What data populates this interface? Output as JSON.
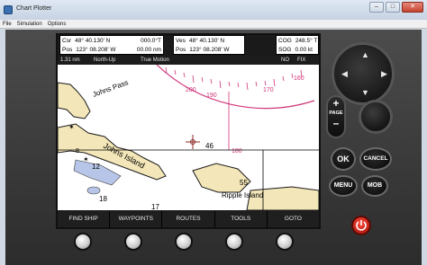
{
  "window": {
    "title": "Chart Plotter",
    "menu": [
      "File",
      "Simulation",
      "Options"
    ]
  },
  "nav_info": {
    "box1": {
      "line1": [
        "Csr",
        "48° 40.130' N",
        "000.0°T"
      ],
      "line2": [
        "Pos",
        "123° 08.208' W",
        "00.00 nm"
      ]
    },
    "box2": {
      "line1": [
        "Ves",
        "48° 40.130' N"
      ],
      "line2": [
        "Pos",
        "123° 08.208' W"
      ]
    },
    "box3": {
      "line1": [
        "COG",
        "248.5° T"
      ],
      "line2": [
        "SOG",
        "0.00 kt"
      ]
    }
  },
  "mode_bar": {
    "range": "1.31 nm",
    "orientation": "North-Up",
    "motion": "True Motion",
    "status1": "NO",
    "status2": "FIX"
  },
  "chart": {
    "places": [
      "Johns Pass",
      "Johns Island",
      "Ripple Island"
    ],
    "compass_labels": [
      "200",
      "190",
      "180",
      "170",
      "160"
    ],
    "soundings": [
      "46",
      "12",
      "18",
      "17",
      "55",
      "8"
    ],
    "colors": {
      "land": "#f3e6b8",
      "land_outline": "#1a1a1a",
      "shallow": "#b7c5e8",
      "compass": "#d0357b"
    }
  },
  "softkeys": [
    "FIND SHIP",
    "WAYPOINTS",
    "ROUTES",
    "TOOLS",
    "GOTO"
  ],
  "controls": {
    "page_label": "PAGE",
    "page_plus": "+",
    "page_minus": "–",
    "ok": "OK",
    "cancel": "CANCEL",
    "menu": "MENU",
    "mob": "MOB"
  }
}
